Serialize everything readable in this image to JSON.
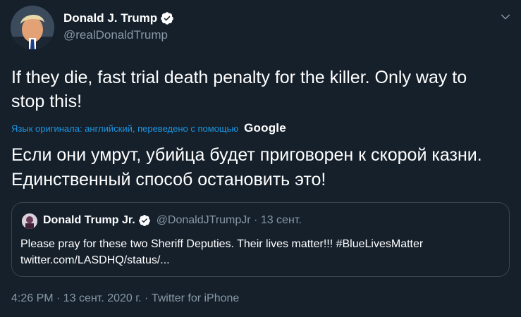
{
  "author": {
    "display_name": "Donald J. Trump",
    "handle": "@realDonaldTrump",
    "verified": true
  },
  "tweet": {
    "text": "If they die, fast trial death penalty for the killer. Only way to stop this!",
    "translation_note": "Язык оригинала: английский, переведено с помощью",
    "translation_provider": "Google",
    "translated_text": "Если они умрут, убийца будет приговорен к скорой казни. Единственный способ остановить это!"
  },
  "quoted_tweet": {
    "display_name": "Donald Trump Jr.",
    "verified": true,
    "meta": "@DonaldJTrumpJr · 13 сент.",
    "text_line1": "Please pray for these two Sheriff Deputies. Their lives matter!!! #BlueLivesMatter",
    "text_line2": "twitter.com/LASDHQ/status/..."
  },
  "footer": {
    "timestamp_source": "4:26 PM · 13 сент. 2020 г. · Twitter for iPhone"
  },
  "colors": {
    "background": "#15202b",
    "muted_text": "#8899a6",
    "link": "#1b95e0",
    "verified_badge": "#ffffff",
    "card_border": "#38444d"
  },
  "icons": {
    "verified": "verified-badge-icon",
    "menu": "chevron-down-icon"
  }
}
